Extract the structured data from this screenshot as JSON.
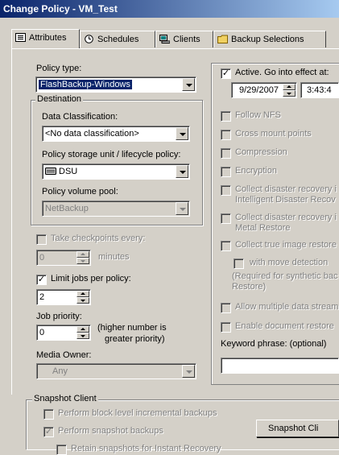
{
  "window": {
    "title": "Change Policy - VM_Test"
  },
  "tabs": [
    {
      "label": "Attributes",
      "icon": "attributes-icon"
    },
    {
      "label": "Schedules",
      "icon": "clock-icon"
    },
    {
      "label": "Clients",
      "icon": "computer-icon"
    },
    {
      "label": "Backup Selections",
      "icon": "folder-icon"
    }
  ],
  "left": {
    "policy_type_label": "Policy type:",
    "policy_type_value": "FlashBackup-Windows",
    "destination_label": "Destination",
    "data_class_label": "Data Classification:",
    "data_class_value": "<No data classification>",
    "storage_label": "Policy storage unit / lifecycle policy:",
    "storage_value": "DSU",
    "volume_label": "Policy volume pool:",
    "volume_value": "NetBackup",
    "checkpoint_label": "Take checkpoints every:",
    "checkpoint_value": "0",
    "checkpoint_unit": "minutes",
    "limit_label": "Limit jobs per policy:",
    "limit_value": "2",
    "priority_label": "Job priority:",
    "priority_value": "0",
    "priority_hint_1": "(higher number is",
    "priority_hint_2": "greater priority)",
    "owner_label": "Media Owner:",
    "owner_value": "Any"
  },
  "right": {
    "active_label": "Active. Go into effect at:",
    "date_value": "9/29/2007",
    "time_value": "3:43:4",
    "options": [
      "Follow NFS",
      "Cross mount points",
      "Compression",
      "Encryption",
      "Collect disaster recovery i",
      "Intelligent Disaster Recov",
      "Collect disaster recovery i",
      "Metal Restore",
      "Collect true image restore",
      "with move detection",
      "(Required for synthetic bac",
      "Restore)",
      "Allow multiple data stream",
      "Enable document restore"
    ],
    "keyword_label": "Keyword phrase: (optional)"
  },
  "snapshot": {
    "group_label": "Snapshot Client",
    "opt_block": "Perform block level incremental backups",
    "opt_snapshot": "Perform snapshot backups",
    "opt_retain": "Retain snapshots for Instant Recovery",
    "button_label": "Snapshot Cli"
  }
}
